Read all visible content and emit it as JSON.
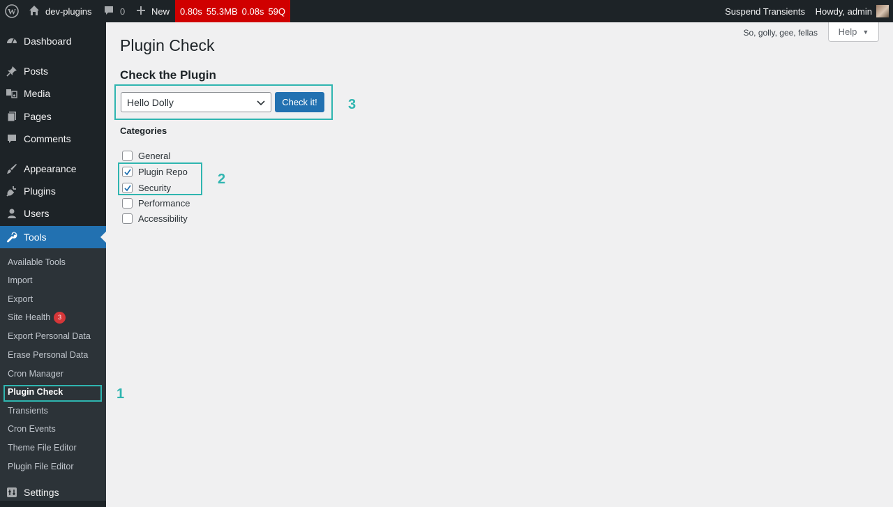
{
  "adminbar": {
    "site_name": "dev-plugins",
    "comment_count": "0",
    "new_label": "New",
    "qm": [
      "0.80s",
      "55.3MB",
      "0.08s",
      "59Q"
    ],
    "suspend_transients": "Suspend Transients",
    "howdy": "Howdy, admin"
  },
  "sidebar": {
    "items": [
      {
        "label": "Dashboard",
        "icon": "dashboard-icon"
      },
      {
        "label": "Posts",
        "icon": "pin-icon"
      },
      {
        "label": "Media",
        "icon": "media-icon"
      },
      {
        "label": "Pages",
        "icon": "pages-icon"
      },
      {
        "label": "Comments",
        "icon": "comment-icon"
      },
      {
        "label": "Appearance",
        "icon": "brush-icon"
      },
      {
        "label": "Plugins",
        "icon": "plug-icon"
      },
      {
        "label": "Users",
        "icon": "user-icon"
      },
      {
        "label": "Tools",
        "icon": "wrench-icon"
      },
      {
        "label": "Settings",
        "icon": "sliders-icon"
      }
    ],
    "tools_submenu": [
      "Available Tools",
      "Import",
      "Export",
      "Site Health",
      "Export Personal Data",
      "Erase Personal Data",
      "Cron Manager",
      "Plugin Check",
      "Transients",
      "Cron Events",
      "Theme File Editor",
      "Plugin File Editor"
    ],
    "site_health_badge": "3"
  },
  "header": {
    "screen_meta_text": "So, golly, gee, fellas",
    "help_label": "Help"
  },
  "main": {
    "page_title": "Plugin Check",
    "section_title": "Check the Plugin",
    "plugin_select_value": "Hello Dolly",
    "check_button": "Check it!",
    "categories_label": "Categories",
    "categories": [
      {
        "label": "General",
        "checked": false
      },
      {
        "label": "Plugin Repo",
        "checked": true
      },
      {
        "label": "Security",
        "checked": true
      },
      {
        "label": "Performance",
        "checked": false
      },
      {
        "label": "Accessibility",
        "checked": false
      }
    ]
  },
  "annotations": [
    "1",
    "2",
    "3"
  ],
  "colors": {
    "accent": "#2271b1",
    "admin_bg": "#1d2327",
    "highlight": "#2fb5b0",
    "qm_red": "#d00000"
  }
}
